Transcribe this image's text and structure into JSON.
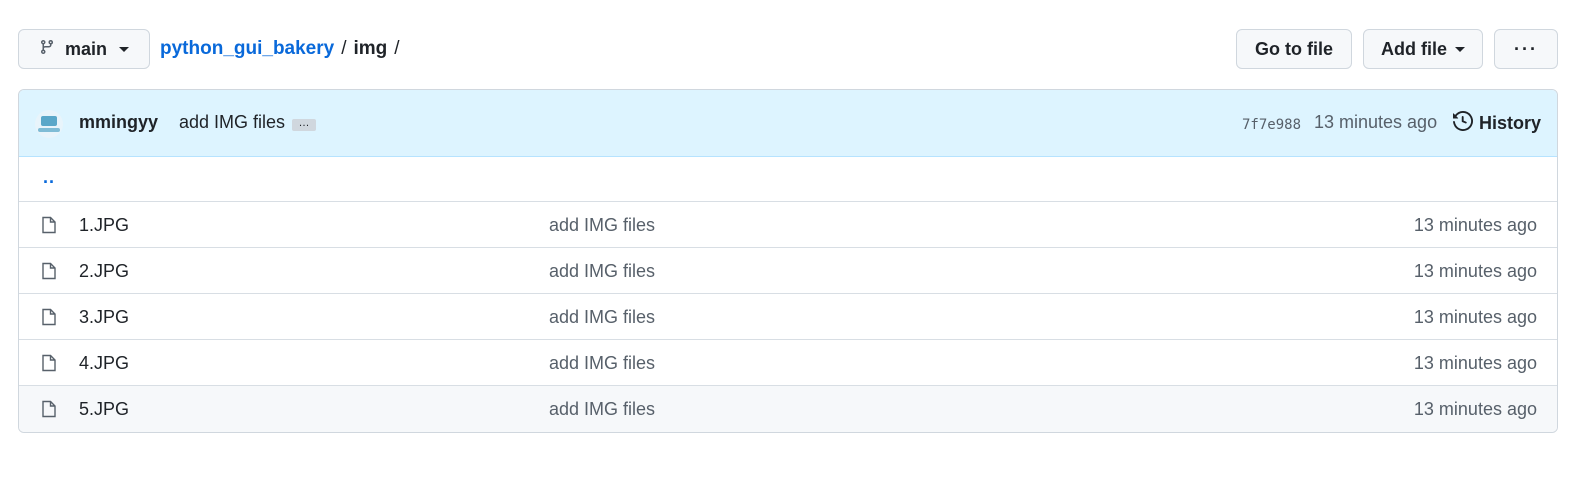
{
  "branch": {
    "label": "main"
  },
  "breadcrumb": {
    "repo": "python_gui_bakery",
    "sep1": "/",
    "dir": "img",
    "sep2": "/"
  },
  "actions": {
    "go_to_file": "Go to file",
    "add_file": "Add file",
    "more": "···"
  },
  "commit": {
    "author": "mmingyy",
    "message": "add IMG files",
    "ellipsis": "…",
    "sha": "7f7e988",
    "time": "13 minutes ago",
    "history_label": "History"
  },
  "files": {
    "parent_link": "..",
    "rows": [
      {
        "name": "1.JPG",
        "message": "add IMG files",
        "time": "13 minutes ago"
      },
      {
        "name": "2.JPG",
        "message": "add IMG files",
        "time": "13 minutes ago"
      },
      {
        "name": "3.JPG",
        "message": "add IMG files",
        "time": "13 minutes ago"
      },
      {
        "name": "4.JPG",
        "message": "add IMG files",
        "time": "13 minutes ago"
      },
      {
        "name": "5.JPG",
        "message": "add IMG files",
        "time": "13 minutes ago"
      }
    ]
  },
  "icons": [
    "git-branch-icon",
    "caret-down-icon",
    "history-icon",
    "file-icon",
    "avatar"
  ],
  "colors": {
    "link": "#0969da",
    "commit_bar_bg": "#ddf4ff",
    "muted_text": "#57606a",
    "border": "#d0d7de"
  }
}
